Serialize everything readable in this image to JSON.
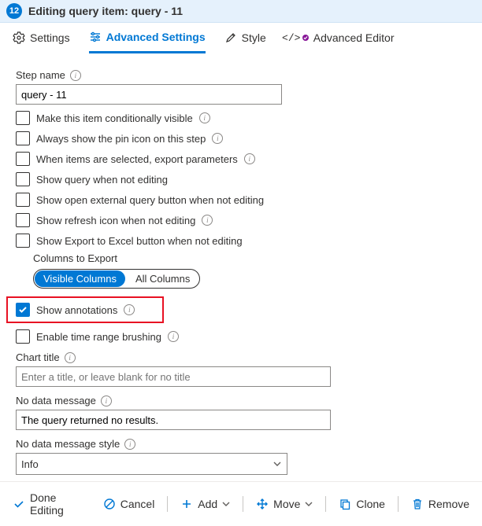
{
  "header": {
    "badge": "12",
    "title": "Editing query item: query - 11"
  },
  "tabs": {
    "settings": "Settings",
    "advanced": "Advanced Settings",
    "style": "Style",
    "editor": "Advanced Editor"
  },
  "stepName": {
    "label": "Step name",
    "value": "query - 11"
  },
  "checks": {
    "conditional": "Make this item conditionally visible",
    "pin": "Always show the pin icon on this step",
    "export": "When items are selected, export parameters",
    "showQuery": "Show query when not editing",
    "openExternal": "Show open external query button when not editing",
    "refresh": "Show refresh icon when not editing",
    "excel": "Show Export to Excel button when not editing"
  },
  "columnsExport": {
    "label": "Columns to Export",
    "visible": "Visible Columns",
    "all": "All Columns"
  },
  "showAnnotations": "Show annotations",
  "timeBrush": "Enable time range brushing",
  "chartTitle": {
    "label": "Chart title",
    "placeholder": "Enter a title, or leave blank for no title"
  },
  "noData": {
    "label": "No data message",
    "value": "The query returned no results."
  },
  "noDataStyle": {
    "label": "No data message style",
    "value": "Info"
  },
  "footer": {
    "done": "Done Editing",
    "cancel": "Cancel",
    "add": "Add",
    "move": "Move",
    "clone": "Clone",
    "remove": "Remove"
  }
}
